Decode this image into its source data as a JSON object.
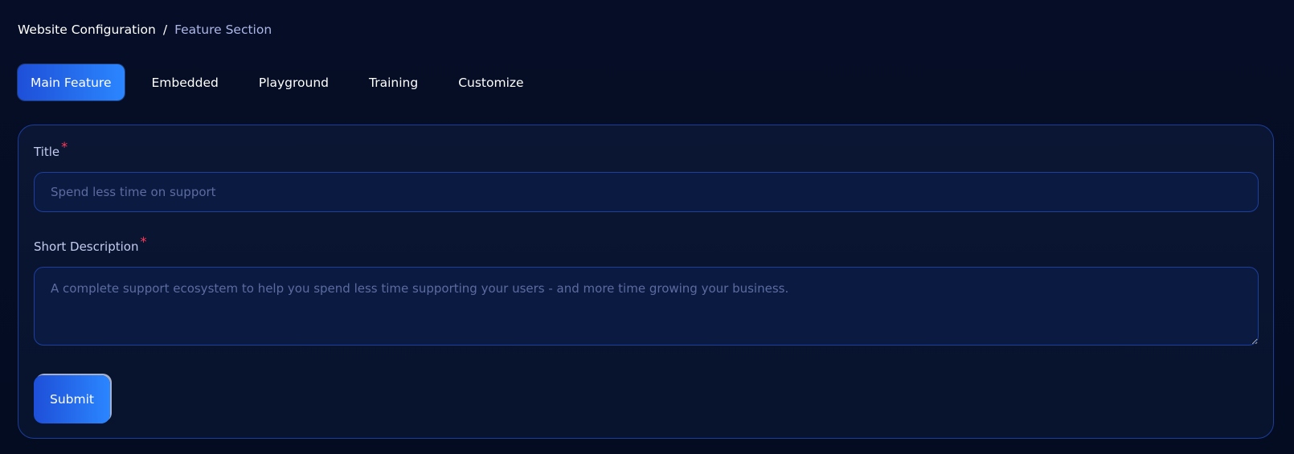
{
  "breadcrumb": {
    "root": "Website Configuration",
    "separator": "/",
    "current": "Feature Section"
  },
  "tabs": [
    {
      "label": "Main Feature",
      "active": true
    },
    {
      "label": "Embedded",
      "active": false
    },
    {
      "label": "Playground",
      "active": false
    },
    {
      "label": "Training",
      "active": false
    },
    {
      "label": "Customize",
      "active": false
    }
  ],
  "form": {
    "title": {
      "label": "Title",
      "required_mark": "*",
      "value": "",
      "placeholder": "Spend less time on support"
    },
    "short_description": {
      "label": "Short Description",
      "required_mark": "*",
      "value": "",
      "placeholder": "A complete support ecosystem to help you spend less time supporting your users - and more time growing your business."
    },
    "submit_label": "Submit"
  },
  "colors": {
    "background": "#040d24",
    "card": "#0a1633",
    "border": "#1d3d9a",
    "accent_start": "#1e4fd8",
    "accent_end": "#2b86ff",
    "required": "#ff3b5a",
    "placeholder": "#5c6ba0"
  }
}
